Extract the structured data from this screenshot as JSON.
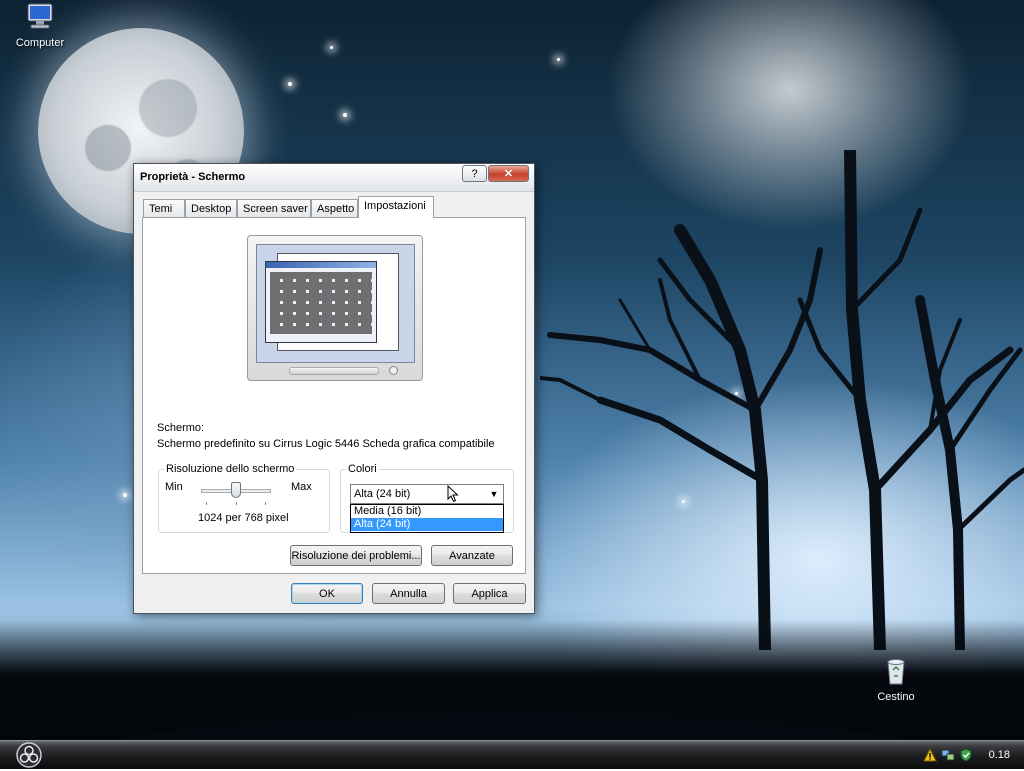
{
  "desktop": {
    "icons": [
      {
        "label": "Computer"
      },
      {
        "label": "Cestino"
      }
    ]
  },
  "taskbar": {
    "clock": "0.18"
  },
  "dialog": {
    "title": "Proprietà - Schermo",
    "help_label": "?",
    "close_label": "✕",
    "tabs": [
      {
        "label": "Temi"
      },
      {
        "label": "Desktop"
      },
      {
        "label": "Screen saver"
      },
      {
        "label": "Aspetto"
      },
      {
        "label": "Impostazioni",
        "active": true
      }
    ],
    "settings": {
      "display_label": "Schermo:",
      "display_value": "Schermo predefinito su Cirrus Logic 5446 Scheda grafica compatibile",
      "resolution": {
        "legend": "Risoluzione dello schermo",
        "min_label": "Min",
        "max_label": "Max",
        "value": "1024 per 768 pixel",
        "slider_level": 0.5
      },
      "colors": {
        "legend": "Colori",
        "selected": "Alta (24 bit)",
        "options": [
          "Media (16 bit)",
          "Alta (24 bit)"
        ],
        "highlighted_option": "Alta (24 bit)"
      },
      "troubleshoot_label": "Risoluzione dei problemi...",
      "advanced_label": "Avanzate"
    },
    "buttons": {
      "ok": "OK",
      "cancel": "Annulla",
      "apply": "Applica"
    }
  },
  "colors": {
    "selection": "#3399ff",
    "close_button": "#c7402a",
    "taskbar": "#1b1c1e"
  }
}
